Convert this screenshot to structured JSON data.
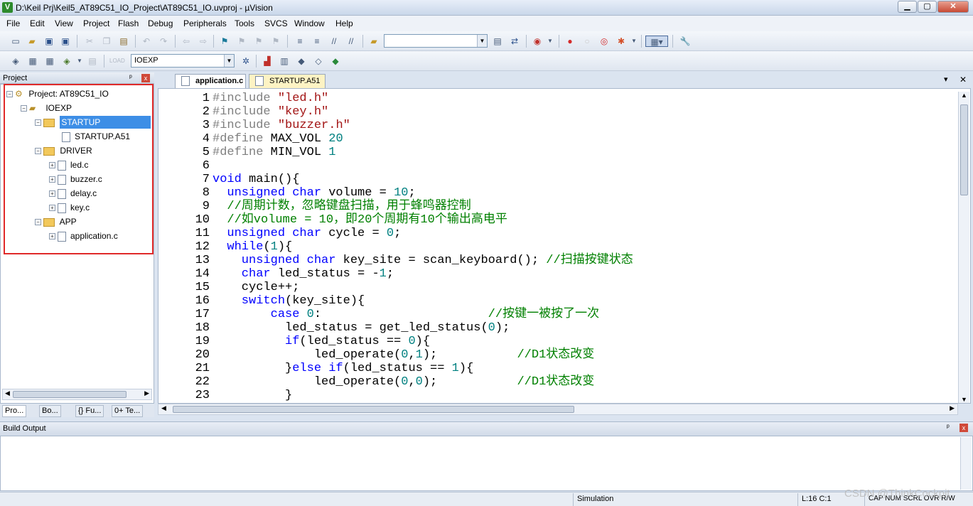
{
  "window": {
    "title": "D:\\Keil Prj\\Keil5_AT89C51_IO_Project\\AT89C51_IO.uvproj - µVision",
    "min": "▁",
    "max": "▢",
    "close": "✕"
  },
  "menu": [
    "File",
    "Edit",
    "View",
    "Project",
    "Flash",
    "Debug",
    "Peripherals",
    "Tools",
    "SVCS",
    "Window",
    "Help"
  ],
  "toolbar2": {
    "target_value": "IOEXP"
  },
  "project_panel": {
    "title": "Project",
    "pin": "ᵖ",
    "close": "x"
  },
  "tree": {
    "project": "Project: AT89C51_IO",
    "target": "IOEXP",
    "groups": [
      {
        "name": "STARTUP",
        "selected": true,
        "files": [
          "STARTUP.A51"
        ]
      },
      {
        "name": "DRIVER",
        "selected": false,
        "files": [
          "led.c",
          "buzzer.c",
          "delay.c",
          "key.c"
        ]
      },
      {
        "name": "APP",
        "selected": false,
        "files": [
          "application.c"
        ]
      }
    ]
  },
  "bottom_tabs": [
    "Pro...",
    "Bo...",
    "{} Fu...",
    "0+ Te..."
  ],
  "editor_tabs": [
    {
      "label": "application.c",
      "active": true
    },
    {
      "label": "STARTUP.A51",
      "active": false
    }
  ],
  "editor_menu": {
    "down": "▾",
    "close": "✕"
  },
  "code": [
    {
      "n": "1",
      "parts": [
        {
          "t": "#include ",
          "c": "#808080"
        },
        {
          "t": "\"led.h\"",
          "c": "#a31515"
        }
      ]
    },
    {
      "n": "2",
      "parts": [
        {
          "t": "#include ",
          "c": "#808080"
        },
        {
          "t": "\"key.h\"",
          "c": "#a31515"
        }
      ]
    },
    {
      "n": "3",
      "parts": [
        {
          "t": "#include ",
          "c": "#808080"
        },
        {
          "t": "\"buzzer.h\"",
          "c": "#a31515"
        }
      ]
    },
    {
      "n": "4",
      "parts": [
        {
          "t": "#define ",
          "c": "#808080"
        },
        {
          "t": "MAX_VOL ",
          "c": "#000000"
        },
        {
          "t": "20",
          "c": "#008080"
        }
      ]
    },
    {
      "n": "5",
      "parts": [
        {
          "t": "#define ",
          "c": "#808080"
        },
        {
          "t": "MIN_VOL ",
          "c": "#000000"
        },
        {
          "t": "1",
          "c": "#008080"
        }
      ]
    },
    {
      "n": "6",
      "parts": []
    },
    {
      "n": "7",
      "parts": [
        {
          "t": "void ",
          "c": "#0000ff"
        },
        {
          "t": "main(){",
          "c": "#000000"
        }
      ]
    },
    {
      "n": "8",
      "parts": [
        {
          "t": "  unsigned char ",
          "c": "#0000ff"
        },
        {
          "t": "volume = ",
          "c": "#000000"
        },
        {
          "t": "10",
          "c": "#008080"
        },
        {
          "t": ";",
          "c": "#000000"
        }
      ]
    },
    {
      "n": "9",
      "parts": [
        {
          "t": "  //周期计数，忽略键盘扫描，用于蜂鸣器控制",
          "c": "#008000"
        }
      ]
    },
    {
      "n": "10",
      "parts": [
        {
          "t": "  //如volume = 10，即20个周期有10个输出高电平",
          "c": "#008000"
        }
      ]
    },
    {
      "n": "11",
      "parts": [
        {
          "t": "  unsigned char ",
          "c": "#0000ff"
        },
        {
          "t": "cycle = ",
          "c": "#000000"
        },
        {
          "t": "0",
          "c": "#008080"
        },
        {
          "t": ";",
          "c": "#000000"
        }
      ]
    },
    {
      "n": "12",
      "parts": [
        {
          "t": "  while",
          "c": "#0000ff"
        },
        {
          "t": "(",
          "c": "#000000"
        },
        {
          "t": "1",
          "c": "#008080"
        },
        {
          "t": "){",
          "c": "#000000"
        }
      ]
    },
    {
      "n": "13",
      "parts": [
        {
          "t": "    unsigned char ",
          "c": "#0000ff"
        },
        {
          "t": "key_site = scan_keyboard(); ",
          "c": "#000000"
        },
        {
          "t": "//扫描按键状态",
          "c": "#008000"
        }
      ]
    },
    {
      "n": "14",
      "parts": [
        {
          "t": "    char ",
          "c": "#0000ff"
        },
        {
          "t": "led_status = -",
          "c": "#000000"
        },
        {
          "t": "1",
          "c": "#008080"
        },
        {
          "t": ";",
          "c": "#000000"
        }
      ]
    },
    {
      "n": "15",
      "parts": [
        {
          "t": "    cycle++;",
          "c": "#000000"
        }
      ]
    },
    {
      "n": "16",
      "parts": [
        {
          "t": "    switch",
          "c": "#0000ff"
        },
        {
          "t": "(key_site){",
          "c": "#000000"
        }
      ]
    },
    {
      "n": "17",
      "parts": [
        {
          "t": "        case ",
          "c": "#0000ff"
        },
        {
          "t": "0",
          "c": "#008080"
        },
        {
          "t": ":                       ",
          "c": "#000000"
        },
        {
          "t": "//按键一被按了一次",
          "c": "#008000"
        }
      ]
    },
    {
      "n": "18",
      "parts": [
        {
          "t": "          led_status = get_led_status(",
          "c": "#000000"
        },
        {
          "t": "0",
          "c": "#008080"
        },
        {
          "t": ");",
          "c": "#000000"
        }
      ]
    },
    {
      "n": "19",
      "parts": [
        {
          "t": "          if",
          "c": "#0000ff"
        },
        {
          "t": "(led_status == ",
          "c": "#000000"
        },
        {
          "t": "0",
          "c": "#008080"
        },
        {
          "t": "){",
          "c": "#000000"
        }
      ]
    },
    {
      "n": "20",
      "parts": [
        {
          "t": "              led_operate(",
          "c": "#000000"
        },
        {
          "t": "0",
          "c": "#008080"
        },
        {
          "t": ",",
          "c": "#000000"
        },
        {
          "t": "1",
          "c": "#008080"
        },
        {
          "t": ");           ",
          "c": "#000000"
        },
        {
          "t": "//D1状态改变",
          "c": "#008000"
        }
      ]
    },
    {
      "n": "21",
      "parts": [
        {
          "t": "          }",
          "c": "#000000"
        },
        {
          "t": "else if",
          "c": "#0000ff"
        },
        {
          "t": "(led_status == ",
          "c": "#000000"
        },
        {
          "t": "1",
          "c": "#008080"
        },
        {
          "t": "){",
          "c": "#000000"
        }
      ]
    },
    {
      "n": "22",
      "parts": [
        {
          "t": "              led_operate(",
          "c": "#000000"
        },
        {
          "t": "0",
          "c": "#008080"
        },
        {
          "t": ",",
          "c": "#000000"
        },
        {
          "t": "0",
          "c": "#008080"
        },
        {
          "t": ");           ",
          "c": "#000000"
        },
        {
          "t": "//D1状态改变",
          "c": "#008000"
        }
      ]
    },
    {
      "n": "23",
      "parts": [
        {
          "t": "          }",
          "c": "#000000"
        }
      ]
    }
  ],
  "build_output": {
    "title": "Build Output"
  },
  "status": {
    "mode": "Simulation",
    "position": "L:16 C:1",
    "flags": "CAP  NUM  SCRL  OVR  R/W"
  },
  "watermark": "CSDN @ThinkCockpit"
}
